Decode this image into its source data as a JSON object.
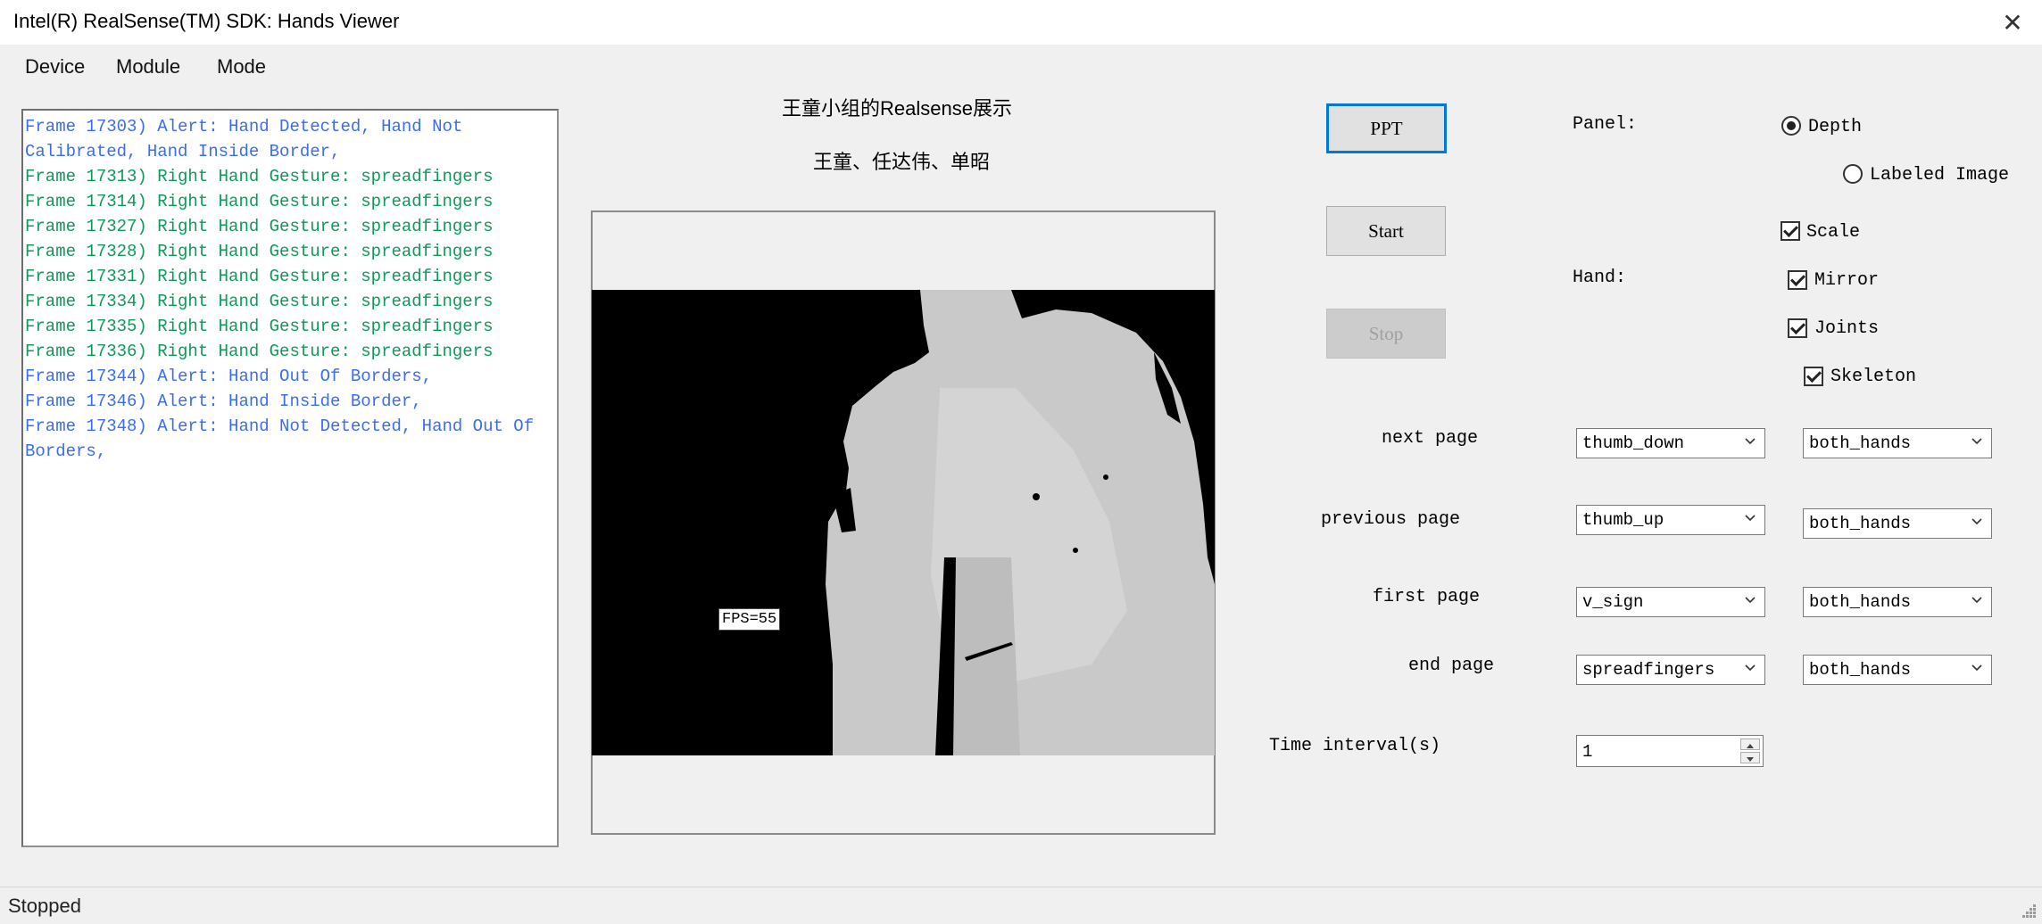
{
  "window": {
    "title": "Intel(R) RealSense(TM) SDK: Hands Viewer",
    "close_glyph": "✕"
  },
  "menu": {
    "items": [
      "Device",
      "Module",
      "Mode"
    ]
  },
  "log": {
    "lines": [
      {
        "text": "Frame 17303) Alert: Hand Detected, Hand Not Calibrated, Hand Inside Border,",
        "color": "blue"
      },
      {
        "text": "Frame 17313) Right Hand Gesture: spreadfingers",
        "color": "green"
      },
      {
        "text": "Frame 17314) Right Hand Gesture: spreadfingers",
        "color": "green"
      },
      {
        "text": "Frame 17327) Right Hand Gesture: spreadfingers",
        "color": "green"
      },
      {
        "text": "Frame 17328) Right Hand Gesture: spreadfingers",
        "color": "green"
      },
      {
        "text": "Frame 17331) Right Hand Gesture: spreadfingers",
        "color": "green"
      },
      {
        "text": "Frame 17334) Right Hand Gesture: spreadfingers",
        "color": "green"
      },
      {
        "text": "Frame 17335) Right Hand Gesture: spreadfingers",
        "color": "green"
      },
      {
        "text": "Frame 17336) Right Hand Gesture: spreadfingers",
        "color": "green"
      },
      {
        "text": "Frame 17344) Alert: Hand Out Of Borders,",
        "color": "blue"
      },
      {
        "text": "Frame 17346) Alert: Hand Inside Border,",
        "color": "blue"
      },
      {
        "text": "Frame 17348) Alert: Hand Not Detected, Hand Out Of Borders,",
        "color": "blue"
      }
    ]
  },
  "heading": {
    "title": "王童小组的Realsense展示",
    "members": "王童、任达伟、单昭"
  },
  "video": {
    "fps": "FPS=55"
  },
  "buttons": {
    "ppt": "PPT",
    "start": "Start",
    "stop": "Stop"
  },
  "panel": {
    "label": "Panel:",
    "depth": "Depth",
    "labeled_image": "Labeled Image",
    "scale": "Scale"
  },
  "hand": {
    "label": "Hand:",
    "mirror": "Mirror",
    "joints": "Joints",
    "skeleton": "Skeleton"
  },
  "gestures": {
    "next_page": {
      "label": "next page",
      "gesture": "thumb_down",
      "hand": "both_hands"
    },
    "previous_page": {
      "label": "previous page",
      "gesture": "thumb_up",
      "hand": "both_hands"
    },
    "first_page": {
      "label": "first page",
      "gesture": "v_sign",
      "hand": "both_hands"
    },
    "end_page": {
      "label": "end page",
      "gesture": "spreadfingers",
      "hand": "both_hands"
    }
  },
  "interval": {
    "label": "Time interval(s)",
    "value": "1"
  },
  "status": {
    "text": "Stopped"
  },
  "icons": {
    "close": "close-icon",
    "dropdown": "chevron-down-icon",
    "spin_up": "arrow-up-icon",
    "spin_down": "arrow-down-icon",
    "grip": "resize-grip-icon"
  },
  "colors": {
    "log_blue": "#3a6df0",
    "log_green": "#0f9a5a",
    "focus_blue": "#0078d7"
  }
}
